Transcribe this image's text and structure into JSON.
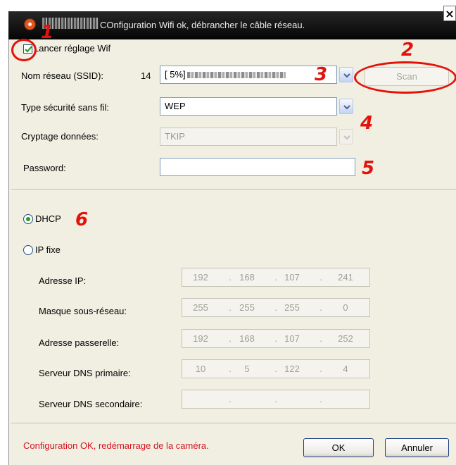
{
  "window": {
    "title": "COnfiguration Wifi ok, débrancher le câble réseau.",
    "close_glyph": "×"
  },
  "wifi": {
    "enable_label": "Lancer réglage Wif",
    "enable_checked": true,
    "ssid_label": "Nom réseau (SSID):",
    "ssid_count": "14",
    "ssid_value": "[ 5%]",
    "scan_label": "Scan",
    "security_label": "Type sécurité sans fil:",
    "security_value": "WEP",
    "encryption_label": "Cryptage données:",
    "encryption_value": "TKIP",
    "password_label": "Password:",
    "password_value": ""
  },
  "network": {
    "dhcp_label": "DHCP",
    "dhcp_selected": true,
    "static_label": "IP fixe",
    "rows": [
      {
        "label": "Adresse IP:",
        "octets": [
          "192",
          "168",
          "107",
          "241"
        ]
      },
      {
        "label": "Masque sous-réseau:",
        "octets": [
          "255",
          "255",
          "255",
          "0"
        ]
      },
      {
        "label": "Adresse passerelle:",
        "octets": [
          "192",
          "168",
          "107",
          "252"
        ]
      },
      {
        "label": "Serveur DNS primaire:",
        "octets": [
          "10",
          "5",
          "122",
          "4"
        ]
      },
      {
        "label": "Serveur DNS secondaire:",
        "octets": [
          "",
          "",
          "",
          ""
        ]
      }
    ]
  },
  "footer": {
    "status": "Configuration OK, redémarrage de la caméra.",
    "ok_label": "OK",
    "cancel_label": "Annuler"
  },
  "annotations": [
    "1",
    "2",
    "3",
    "4",
    "5",
    "6"
  ],
  "colors": {
    "annotation": "#e3120b",
    "status_text": "#d3141e",
    "titlebar": "#0b0b0b",
    "window_bg": "#f1efe2"
  },
  "icons": [
    "camera-icon",
    "close-icon",
    "chevron-down-icon",
    "checkmark-icon"
  ]
}
